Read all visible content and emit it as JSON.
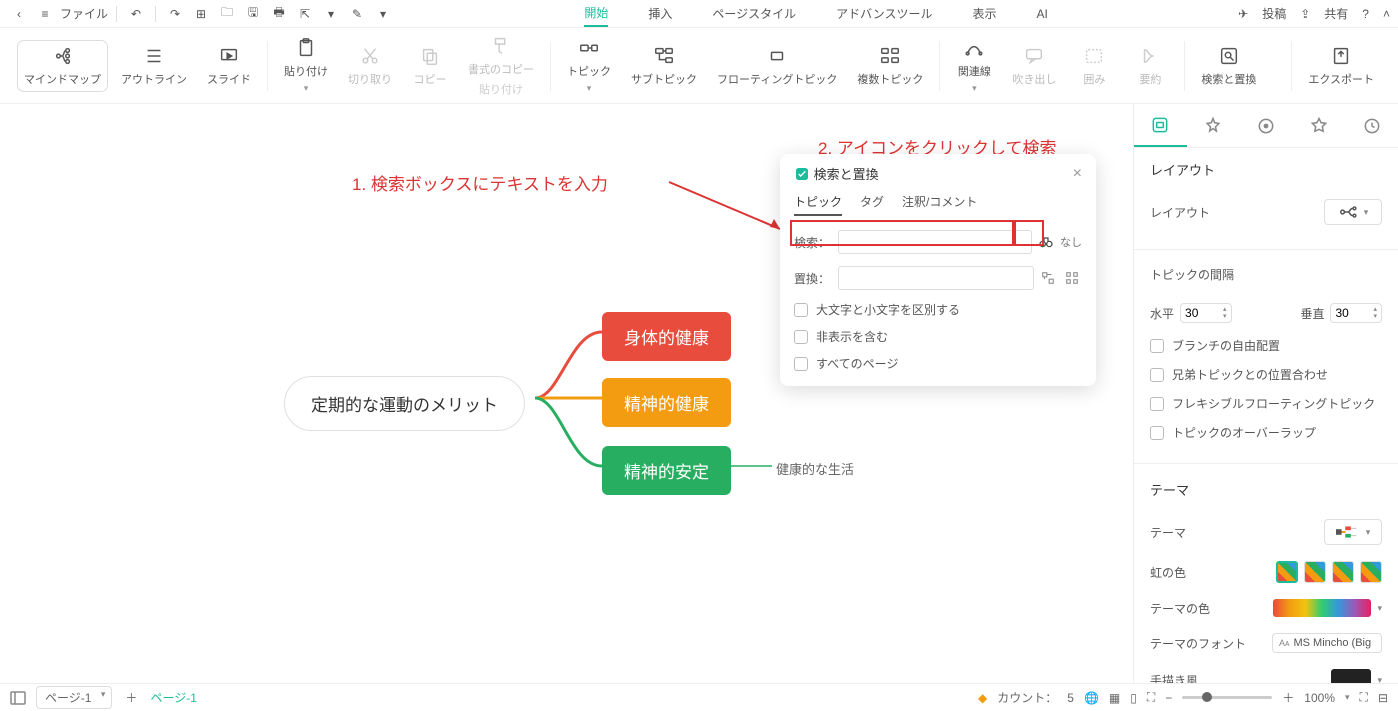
{
  "menubar": {
    "file": "ファイル"
  },
  "menu_tabs": {
    "start": "開始",
    "insert": "挿入",
    "pagestyle": "ページスタイル",
    "advance": "アドバンスツール",
    "display": "表示",
    "ai": "AI"
  },
  "top_right": {
    "post": "投稿",
    "share": "共有"
  },
  "ribbon": {
    "mindmap": "マインドマップ",
    "outline": "アウトライン",
    "slide": "スライド",
    "paste": "貼り付け",
    "cut": "切り取り",
    "copy": "コピー",
    "pastefmt1": "書式のコピー",
    "pastefmt2": "貼り付け",
    "topic": "トピック",
    "subtopic": "サブトピック",
    "floating": "フローティングトピック",
    "multi": "複数トピック",
    "relation": "関連線",
    "callout": "吹き出し",
    "boundary": "囲み",
    "summary": "要約",
    "searchreplace": "検索と置換",
    "export": "エクスポート"
  },
  "annotations": {
    "a1": "1. 検索ボックスにテキストを入力",
    "a2": "2. アイコンをクリックして検索"
  },
  "dialog": {
    "title": "検索と置換",
    "tabs": {
      "topic": "トピック",
      "tag": "タグ",
      "comment": "注釈/コメント"
    },
    "search_label": "検索：",
    "replace_label": "置換：",
    "after_text": "なし",
    "opt_case": "大文字と小文字を区別する",
    "opt_hidden": "非表示を含む",
    "opt_allpages": "すべてのページ"
  },
  "mindmap": {
    "center": "定期的な運動のメリット",
    "n1": "身体的健康",
    "n2": "精神的健康",
    "n3": "精神的安定",
    "leaf": "健康的な生活"
  },
  "panel": {
    "sec_layout": "レイアウト",
    "layout_label": "レイアウト",
    "sec_spacing": "トピックの間隔",
    "h_label": "水平",
    "h_val": "30",
    "v_label": "垂直",
    "v_val": "30",
    "chk_free": "ブランチの自由配置",
    "chk_sibling": "兄弟トピックとの位置合わせ",
    "chk_flexfloat": "フレキシブルフローティングトピック",
    "chk_overlap": "トピックのオーバーラップ",
    "sec_theme": "テーマ",
    "theme_label": "テーマ",
    "rainbow": "虹の色",
    "theme_color": "テーマの色",
    "theme_font": "テーマのフォント",
    "font_val": "MS Mincho (Big",
    "handdraw": "手描き風"
  },
  "status": {
    "page_current": "ページ-1",
    "page_tab": "ページ-1",
    "count_label": "カウント：",
    "count_val": "5",
    "zoom": "100%"
  }
}
